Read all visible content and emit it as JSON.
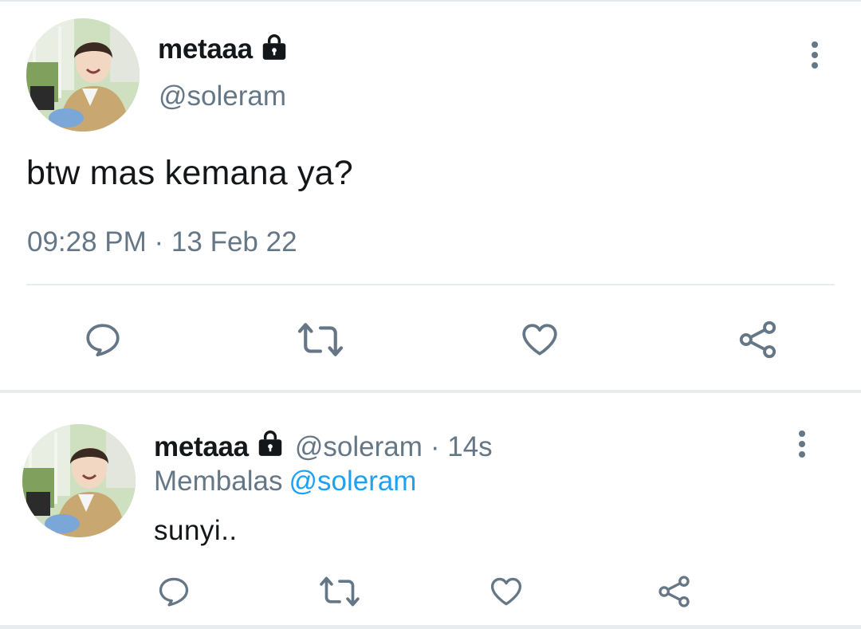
{
  "main_tweet": {
    "display_name": "metaaa",
    "handle": "@soleram",
    "text": "btw mas kemana ya?",
    "timestamp": "09:28 PM · 13 Feb 22",
    "protected_icon": "lock-icon",
    "actions": [
      "reply-icon",
      "retweet-icon",
      "like-icon",
      "share-icon"
    ]
  },
  "reply_tweet": {
    "display_name": "metaaa",
    "handle": "@soleram",
    "time": "· 14s",
    "replying_label": "Membalas",
    "replying_to": "@soleram",
    "text": "sunyi..",
    "protected_icon": "lock-icon",
    "actions": [
      "reply-icon",
      "retweet-icon",
      "like-icon",
      "share-icon"
    ]
  },
  "colors": {
    "text_primary": "#14171a",
    "text_secondary": "#657786",
    "mention": "#1da1f2",
    "divider": "#e6ecf0"
  }
}
